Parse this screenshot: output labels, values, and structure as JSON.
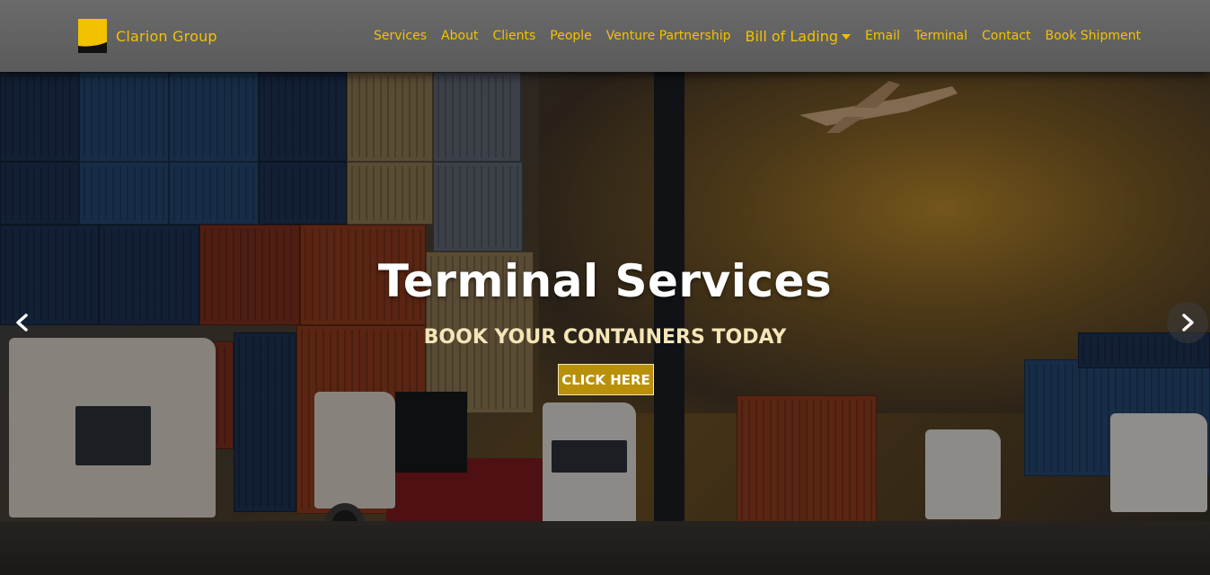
{
  "brand": {
    "name": "Clarion Group",
    "logo_icon": "clarion-logo-icon",
    "accent_color": "#f2c200"
  },
  "nav": {
    "items": [
      {
        "label": "Services"
      },
      {
        "label": "About"
      },
      {
        "label": "Clients"
      },
      {
        "label": "People"
      },
      {
        "label": "Venture Partnership"
      },
      {
        "label": "Bill of Lading",
        "has_dropdown": true
      },
      {
        "label": "Email"
      },
      {
        "label": "Terminal"
      },
      {
        "label": "Contact"
      },
      {
        "label": "Book Shipment"
      }
    ]
  },
  "hero": {
    "title": "Terminal Services",
    "subtitle": "BOOK YOUR CONTAINERS TODAY",
    "cta_label": "CLICK HERE",
    "prev_icon": "chevron-left-icon",
    "next_icon": "chevron-right-icon",
    "background_image": "container-terminal-photo"
  },
  "colors": {
    "cta_bg": "#b8900a",
    "title": "#ffffff",
    "subtitle": "#f5e6b8"
  }
}
